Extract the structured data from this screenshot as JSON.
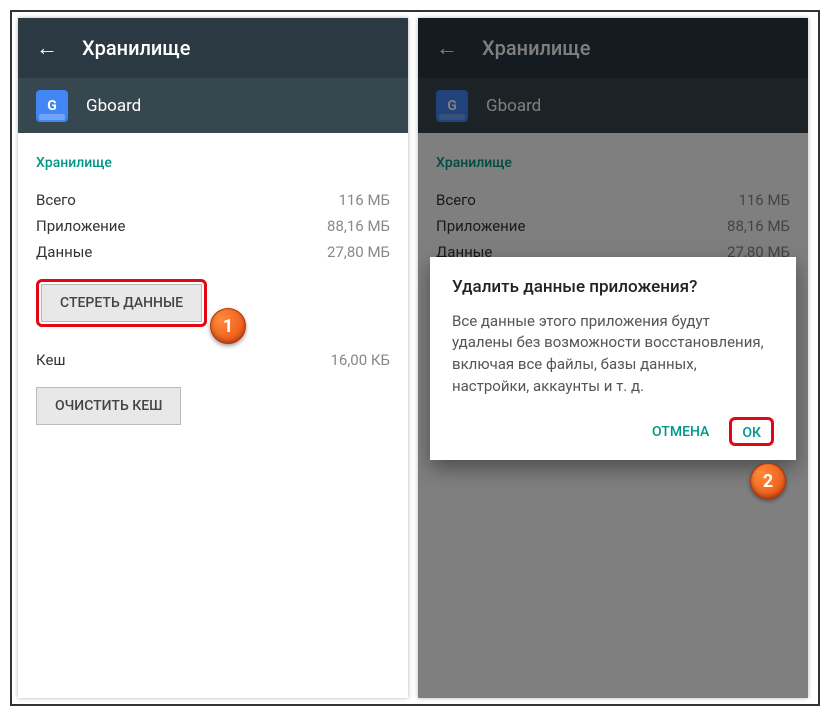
{
  "header": {
    "title": "Хранилище"
  },
  "app": {
    "name": "Gboard",
    "icon_letter": "G"
  },
  "section": {
    "title": "Хранилище"
  },
  "stats": {
    "total_label": "Всего",
    "total_value": "116 МБ",
    "app_label": "Приложение",
    "app_value": "88,16 МБ",
    "data_label": "Данные",
    "data_value": "27,80 МБ",
    "cache_label": "Кеш",
    "cache_value": "16,00 КБ"
  },
  "buttons": {
    "clear_data": "СТЕРЕТЬ ДАННЫЕ",
    "clear_cache": "ОЧИСТИТЬ КЕШ"
  },
  "dialog": {
    "title": "Удалить данные приложения?",
    "text": "Все данные этого приложения будут удалены без возможности восстановления, включая все файлы, базы данных, настройки, аккаунты и т. д.",
    "cancel": "ОТМЕНА",
    "ok": "ОК"
  },
  "badges": {
    "one": "1",
    "two": "2"
  }
}
